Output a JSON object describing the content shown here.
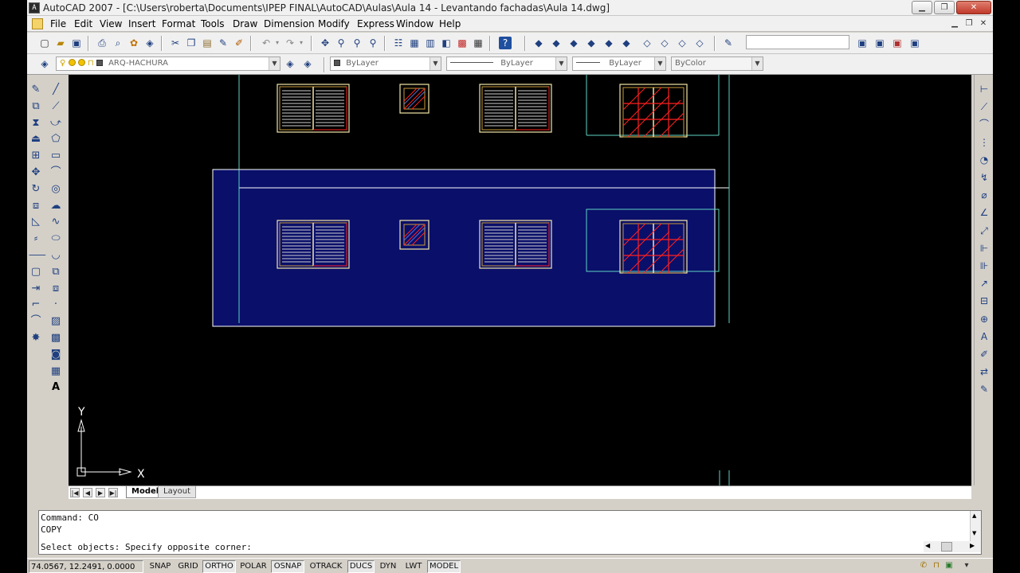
{
  "window": {
    "app_icon": "autocad-app-icon",
    "title": "AutoCAD 2007 - [C:\\Users\\roberta\\Documents\\IPEP FINAL\\AutoCAD\\Aulas\\Aula 14 - Levantando fachadas\\Aula 14.dwg]",
    "buttons": {
      "minimize": "minimize-icon",
      "maximize": "maximize-icon",
      "close": "close-icon"
    }
  },
  "menubar": {
    "doc_icon": "drawing-document-icon",
    "items": [
      "File",
      "Edit",
      "View",
      "Insert",
      "Format",
      "Tools",
      "Draw",
      "Dimension",
      "Modify",
      "Express",
      "Window",
      "Help"
    ],
    "doc_controls": [
      "minimize-icon",
      "restore-icon",
      "close-icon"
    ]
  },
  "toolbar_standard": {
    "icons": [
      "new-icon",
      "open-icon",
      "save-icon",
      "plot-icon",
      "plot-preview-icon",
      "publish-icon",
      "3d-dwf-icon",
      "cut-icon",
      "copy-icon",
      "paste-icon",
      "match-properties-icon",
      "block-editor-icon",
      "undo-icon",
      "redo-icon",
      "pan-icon",
      "zoom-realtime-icon",
      "zoom-window-icon",
      "zoom-previous-icon",
      "properties-icon",
      "design-center-icon",
      "tool-palettes-icon",
      "sheet-set-icon",
      "markup-icon",
      "quickcalc-icon",
      "help-icon"
    ],
    "view_icons": [
      "camera-icon",
      "view-left-icon",
      "view-right-icon",
      "view-top-icon",
      "view-front-icon",
      "view-back-icon",
      "view-iso-sw-icon",
      "view-iso-se-icon",
      "view-iso-ne-icon",
      "view-iso-nw-icon"
    ],
    "right_icons": [
      "edit-text-icon",
      "named-views-icon",
      "new-view-icon",
      "view-manager-icon",
      "viewport-icon"
    ],
    "style_combo_value": ""
  },
  "toolbar_layers": {
    "layer_state_icons": [
      "layer-manager-icon"
    ],
    "layer_flags": [
      "lightbulb-icon",
      "sun-icon",
      "lock-icon",
      "color-square-icon"
    ],
    "current_layer": "ARQ-HACHURA",
    "layer_icons": [
      "make-current-icon",
      "layer-previous-icon"
    ],
    "color": "ByLayer",
    "linetype": "ByLayer",
    "lineweight": "ByLayer",
    "plotstyle": "ByColor"
  },
  "draw_toolbar": [
    "line-icon",
    "construction-line-icon",
    "polyline-icon",
    "polygon-icon",
    "rectangle-icon",
    "arc-icon",
    "circle-icon",
    "revision-cloud-icon",
    "spline-icon",
    "ellipse-icon",
    "ellipse-arc-icon",
    "insert-block-icon",
    "make-block-icon",
    "point-icon",
    "hatch-icon",
    "gradient-icon",
    "region-icon",
    "table-icon",
    "multiline-text-icon"
  ],
  "modify_toolbar": [
    "erase-icon",
    "copy-object-icon",
    "mirror-icon",
    "offset-icon",
    "array-icon",
    "move-icon",
    "rotate-icon",
    "scale-icon",
    "stretch-icon",
    "trim-icon",
    "extend-icon",
    "break-icon",
    "join-icon",
    "chamfer-icon",
    "fillet-icon",
    "explode-icon"
  ],
  "dimension_toolbar": [
    "linear-dim-icon",
    "aligned-dim-icon",
    "arc-length-icon",
    "ordinate-icon",
    "radius-icon",
    "jogged-icon",
    "diameter-icon",
    "angular-icon",
    "quick-dim-icon",
    "baseline-icon",
    "continue-icon",
    "quick-leader-icon",
    "tolerance-icon",
    "center-mark-icon",
    "dim-edit-icon",
    "dim-text-edit-icon",
    "dim-update-icon",
    "dim-style-icon"
  ],
  "ucs": {
    "x_label": "X",
    "y_label": "Y"
  },
  "tabs": {
    "model": "Model",
    "layout": "Layout"
  },
  "command": {
    "history": [
      "Command: CO",
      "COPY"
    ],
    "prompt": "Select objects: Specify opposite corner:"
  },
  "status": {
    "coordinates": "74.0567, 12.2491, 0.0000",
    "toggles": [
      {
        "label": "SNAP",
        "on": false
      },
      {
        "label": "GRID",
        "on": false
      },
      {
        "label": "ORTHO",
        "on": true
      },
      {
        "label": "POLAR",
        "on": false
      },
      {
        "label": "OSNAP",
        "on": true
      },
      {
        "label": "OTRACK",
        "on": false
      },
      {
        "label": "DUCS",
        "on": true
      },
      {
        "label": "DYN",
        "on": false
      },
      {
        "label": "LWT",
        "on": false
      },
      {
        "label": "MODEL",
        "on": true
      }
    ],
    "tray_icons": [
      "communication-center-icon",
      "lock-ui-icon",
      "status-tray-icon",
      "tray-menu-icon"
    ]
  },
  "colors": {
    "canvas_bg": "#000000",
    "window_outline": "#f2e6a6",
    "window_inner": "#c89a3a",
    "hatch_red": "#ff2020",
    "selection_fill": "#0a0f6a",
    "selection_border": "#ffffff",
    "guide_line": "#5fd3c3"
  }
}
